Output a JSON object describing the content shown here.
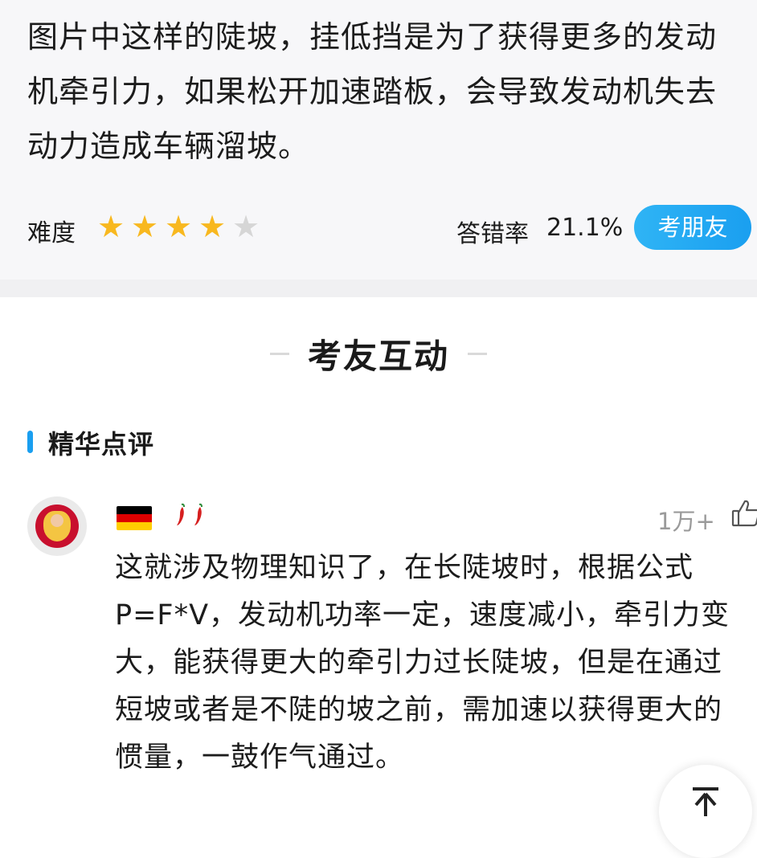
{
  "question": {
    "text": "图片中这样的陡坡，挂低挡是为了获得更多的发动机牵引力，如果松开加速踏板，会导致发动机失去动力造成车辆溜坡。"
  },
  "meta": {
    "difficulty_label": "难度",
    "difficulty_stars": 4,
    "difficulty_max": 5,
    "error_rate_label": "答错率",
    "error_rate_value": "21.1%",
    "exam_friend_button": "考朋友",
    "star_color_on": "#f8b81f",
    "star_color_off": "#d6d6d6"
  },
  "section": {
    "title": "考友互动",
    "subsection_label": "精华点评",
    "accent_color": "#1a9ff0"
  },
  "comment": {
    "badges": [
      "germany-flag",
      "chili-pepper",
      "chili-pepper"
    ],
    "like_count": "1万+",
    "text": "这就涉及物理知识了，在长陡坡时，根据公式P=F*V，发动机功率一定，速度减小，牵引力变大，能获得更大的牵引力过长陡坡，但是在通过短坡或者是不陡的坡之前，需加速以获得更大的惯量，一鼓作气通过。"
  }
}
